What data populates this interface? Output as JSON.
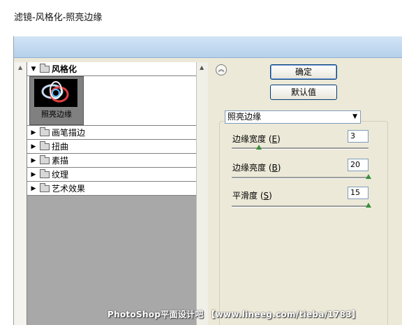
{
  "caption": "滤镜-风格化-照亮边缘",
  "tree": {
    "open_category": "风格化",
    "selected_filter": "照亮边缘",
    "categories": [
      "画笔描边",
      "扭曲",
      "素描",
      "纹理",
      "艺术效果"
    ]
  },
  "buttons": {
    "ok": "确定",
    "default": "默认值"
  },
  "filter_select": "照亮边缘",
  "params": [
    {
      "label": "边缘宽度",
      "key": "E",
      "value": "3",
      "slider_fraction": 0.2
    },
    {
      "label": "边缘亮度",
      "key": "B",
      "value": "20",
      "slider_fraction": 1.0
    },
    {
      "label": "平滑度",
      "key": "S",
      "value": "15",
      "slider_fraction": 1.0
    }
  ],
  "watermark": "PhotoShop平面设计吧 【www.lineeg.com/tieba/1783】",
  "icons": {
    "collapse": "double-chevron-up-icon",
    "folder": "folder-icon"
  }
}
